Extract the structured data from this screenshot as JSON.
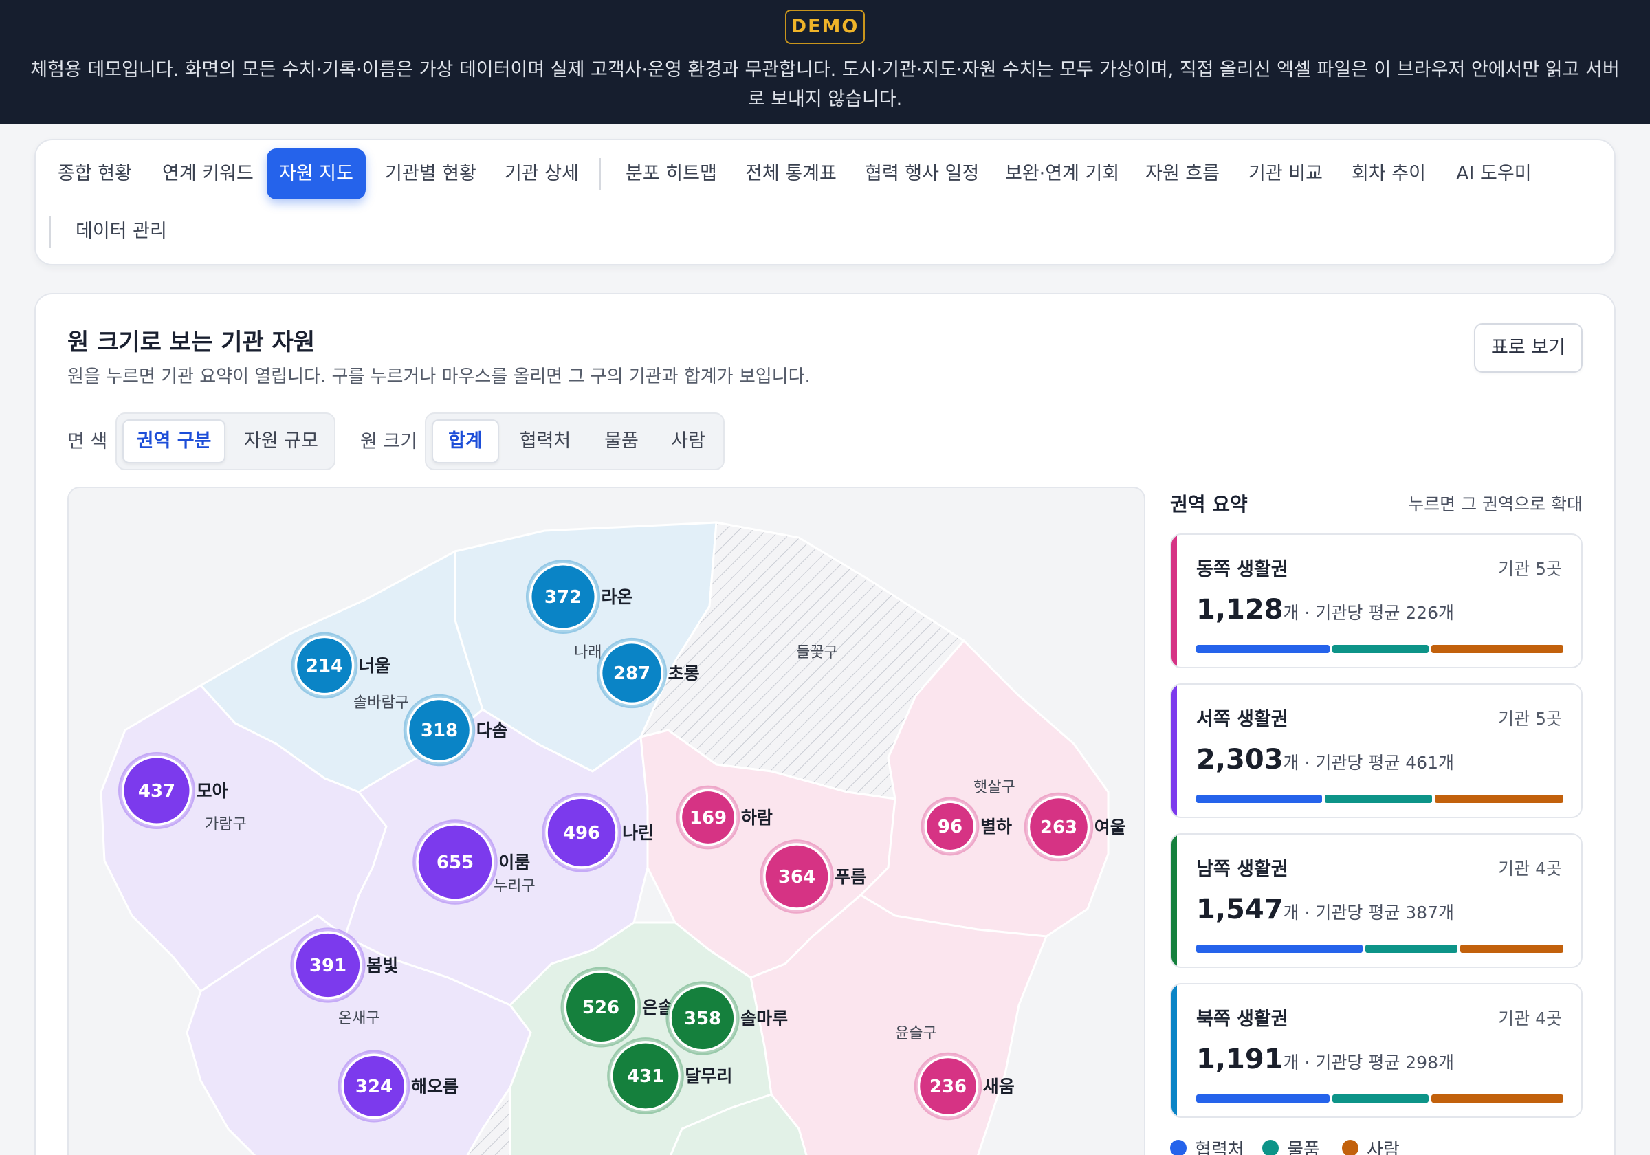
{
  "banner": {
    "badge": "DEMO",
    "text": "체험용 데모입니다. 화면의 모든 수치·기록·이름은 가상 데이터이며 실제 고객사·운영 환경과 무관합니다. 도시·기관·지도·자원 수치는 모두 가상이며, 직접 올리신 엑셀 파일은 이 브라우저 안에서만 읽고 서버로 보내지 않습니다."
  },
  "tabs": [
    {
      "label": "종합 현황"
    },
    {
      "label": "연계 키워드"
    },
    {
      "label": "자원 지도",
      "active": true
    },
    {
      "label": "기관별 현황"
    },
    {
      "label": "기관 상세"
    },
    {
      "label": "분포 히트맵"
    },
    {
      "label": "전체 통계표"
    },
    {
      "label": "협력 행사 일정"
    },
    {
      "label": "보완·연계 기회"
    },
    {
      "label": "자원 흐름"
    },
    {
      "label": "기관 비교"
    },
    {
      "label": "회차 추이"
    },
    {
      "label": "AI 도우미"
    },
    {
      "label": "데이터 관리"
    }
  ],
  "main": {
    "title": "원 크기로 보는 기관 자원",
    "subtitle": "원을 누르면 기관 요약이 열립니다. 구를 누르거나 마우스를 올리면 그 구의 기관과 합계가 보입니다.",
    "table_button": "표로 보기"
  },
  "controls": {
    "fill_label": "면 색",
    "fill_options": [
      "권역 구분",
      "자원 규모"
    ],
    "fill_selected": "권역 구분",
    "size_label": "원 크기",
    "size_options": [
      "합계",
      "협력처",
      "물품",
      "사람"
    ],
    "size_selected": "합계"
  },
  "map": {
    "districts": [
      "들꽃구",
      "솔바람구",
      "나래",
      "가람구",
      "누리구",
      "햇살구",
      "온새구",
      "윤슬구"
    ],
    "colors": {
      "east": "#d63384",
      "west": "#7c3aed",
      "south": "#15803d",
      "north": "#0a84c6"
    },
    "institutions": [
      {
        "name": "라온",
        "value": 372,
        "region": "north"
      },
      {
        "name": "너울",
        "value": 214,
        "region": "north"
      },
      {
        "name": "초롱",
        "value": 287,
        "region": "north"
      },
      {
        "name": "다솜",
        "value": 318,
        "region": "north"
      },
      {
        "name": "모아",
        "value": 437,
        "region": "west"
      },
      {
        "name": "나린",
        "value": 496,
        "region": "west"
      },
      {
        "name": "이룸",
        "value": 655,
        "region": "west"
      },
      {
        "name": "봄빛",
        "value": 391,
        "region": "west"
      },
      {
        "name": "해오름",
        "value": 324,
        "region": "west"
      },
      {
        "name": "하람",
        "value": 169,
        "region": "east"
      },
      {
        "name": "푸름",
        "value": 364,
        "region": "east"
      },
      {
        "name": "별하",
        "value": 96,
        "region": "east"
      },
      {
        "name": "여울",
        "value": 263,
        "region": "east"
      },
      {
        "name": "새움",
        "value": 236,
        "region": "east"
      },
      {
        "name": "은솔",
        "value": 526,
        "region": "south"
      },
      {
        "name": "솔마루",
        "value": 358,
        "region": "south"
      },
      {
        "name": "달무리",
        "value": 431,
        "region": "south"
      }
    ]
  },
  "summary": {
    "title": "권역 요약",
    "hint": "누르면 그 권역으로 확대",
    "regions": [
      {
        "name": "동쪽 생활권",
        "count": "기관 5곳",
        "total": "1,128",
        "suffix": "개 · 기관당 평균 226개",
        "color": "#d63384",
        "split": [
          0.37,
          0.27,
          0.36
        ]
      },
      {
        "name": "서쪽 생활권",
        "count": "기관 5곳",
        "total": "2,303",
        "suffix": "개 · 기관당 평균 461개",
        "color": "#7c3aed",
        "split": [
          0.35,
          0.3,
          0.35
        ]
      },
      {
        "name": "남쪽 생활권",
        "count": "기관 4곳",
        "total": "1,547",
        "suffix": "개 · 기관당 평균 387개",
        "color": "#15803d",
        "split": [
          0.46,
          0.26,
          0.28
        ]
      },
      {
        "name": "북쪽 생활권",
        "count": "기관 4곳",
        "total": "1,191",
        "suffix": "개 · 기관당 평균 298개",
        "color": "#0a84c6",
        "split": [
          0.37,
          0.27,
          0.36
        ]
      }
    ],
    "legend": [
      {
        "label": "협력처",
        "color": "#2563eb"
      },
      {
        "label": "물품",
        "color": "#0d9488"
      },
      {
        "label": "사람",
        "color": "#c2610c"
      }
    ]
  }
}
